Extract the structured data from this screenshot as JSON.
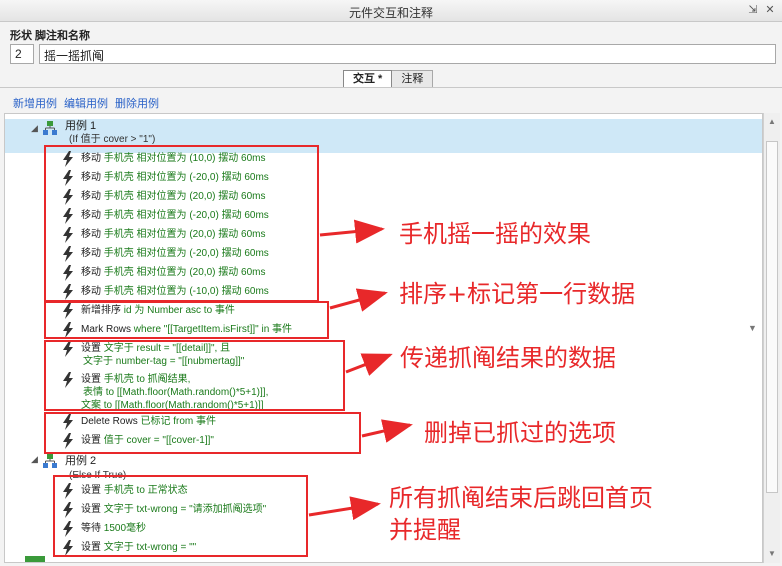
{
  "window": {
    "title": "元件交互和注释"
  },
  "name_section": {
    "label": "形状 脚注和名称",
    "footnote_number": "2",
    "name_value": "摇一摇抓阄"
  },
  "tabs": [
    {
      "label": "交互 *",
      "active": true
    },
    {
      "label": "注释",
      "active": false
    }
  ],
  "links": [
    "新增用例",
    "编辑用例",
    "删除用例"
  ],
  "cases": [
    {
      "title": "用例 1",
      "condition": "(If 值于 cover > \"1\")"
    },
    {
      "title": "用例 2",
      "condition": "(Else If True)"
    }
  ],
  "actions_case1": [
    {
      "verb": "移动",
      "rest": "手机壳 相对位置为 (10,0) 摆动 60ms"
    },
    {
      "verb": "移动",
      "rest": "手机壳 相对位置为 (-20,0) 摆动 60ms"
    },
    {
      "verb": "移动",
      "rest": "手机壳 相对位置为 (20,0) 摆动 60ms"
    },
    {
      "verb": "移动",
      "rest": "手机壳 相对位置为 (-20,0) 摆动 60ms"
    },
    {
      "verb": "移动",
      "rest": "手机壳 相对位置为 (20,0) 摆动 60ms"
    },
    {
      "verb": "移动",
      "rest": "手机壳 相对位置为 (-20,0) 摆动 60ms"
    },
    {
      "verb": "移动",
      "rest": "手机壳 相对位置为 (20,0) 摆动 60ms"
    },
    {
      "verb": "移动",
      "rest": "手机壳 相对位置为 (-10,0) 摆动 60ms"
    },
    {
      "verb": "新增排序",
      "rest": "id 为 Number asc to 事件"
    },
    {
      "verb": "Mark Rows",
      "rest": "where \"[[TargetItem.isFirst]]\"  in 事件"
    },
    {
      "verb": "设置",
      "rest": "文字于 result = \"[[detail]]\", 且",
      "line2": "文字于 number-tag = \"[[nubmertag]]\""
    },
    {
      "verb": "设置",
      "rest": "手机壳 to 抓阄结果,",
      "line2": "表情 to [[Math.floor(Math.random()*5+1)]],",
      "line3": "文案 to [[Math.floor(Math.random()*5+1)]]"
    },
    {
      "verb": "Delete Rows",
      "rest": "已标记 from 事件"
    },
    {
      "verb": "设置",
      "rest": "值于 cover = \"[[cover-1]]\""
    }
  ],
  "actions_case2": [
    {
      "verb": "设置",
      "rest": "手机壳 to 正常状态"
    },
    {
      "verb": "设置",
      "rest": "文字于 txt-wrong = \"请添加抓阄选项\""
    },
    {
      "verb": "等待",
      "rest": "1500毫秒"
    },
    {
      "verb": "设置",
      "rest": "文字于 txt-wrong = \"\""
    }
  ],
  "annotations": [
    "手机摇一摇的效果",
    "排序+标记第一行数据",
    "传递抓阄结果的数据",
    "删掉已抓过的选项",
    "所有抓阄结束后跳回首页",
    "并提醒"
  ],
  "colors": {
    "annotation_red": "#e8282a",
    "action_green": "#1a7a1a",
    "link_blue": "#2a62c8",
    "selection_blue": "#cfe8f7"
  },
  "icons": [
    "pin-icon",
    "close-icon",
    "case-tree-icon",
    "lightning-icon",
    "expand-triangle-icon",
    "scroll-up-icon",
    "scroll-down-icon"
  ]
}
